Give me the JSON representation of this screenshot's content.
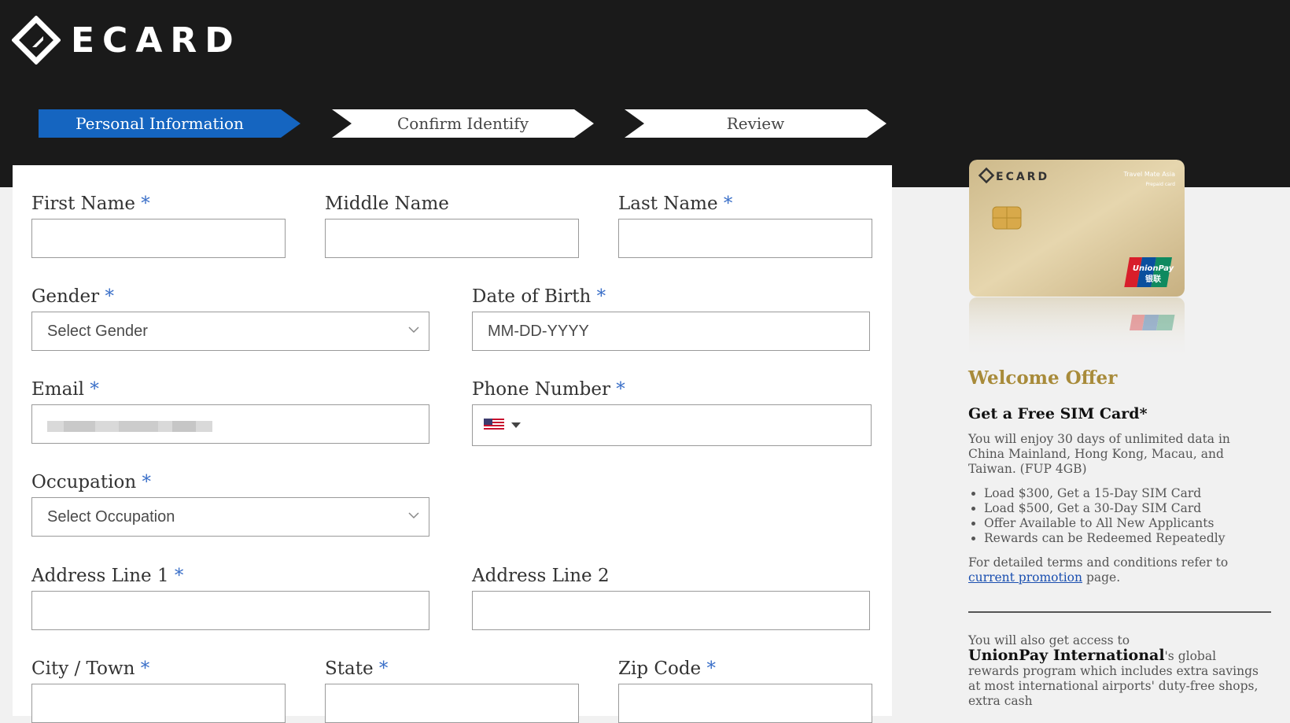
{
  "brand": {
    "name": "ECARD"
  },
  "steps": [
    {
      "label": "Personal Information",
      "active": true
    },
    {
      "label": "Confirm Identify",
      "active": false
    },
    {
      "label": "Review",
      "active": false
    }
  ],
  "form": {
    "first_name": {
      "label": "First Name",
      "required": "*",
      "value": ""
    },
    "middle_name": {
      "label": "Middle Name",
      "value": ""
    },
    "last_name": {
      "label": "Last Name",
      "required": "*",
      "value": ""
    },
    "gender": {
      "label": "Gender",
      "required": "*",
      "selected": "Select Gender"
    },
    "dob": {
      "label": "Date of Birth",
      "required": "*",
      "placeholder": "MM-DD-YYYY"
    },
    "email": {
      "label": "Email",
      "required": "*"
    },
    "phone": {
      "label": "Phone Number",
      "required": "*",
      "country_icon": "us-flag-icon"
    },
    "occupation": {
      "label": "Occupation",
      "required": "*",
      "selected": "Select Occupation"
    },
    "address1": {
      "label": "Address Line 1",
      "required": "*",
      "value": ""
    },
    "address2": {
      "label": "Address Line 2",
      "value": ""
    },
    "city": {
      "label": "City / Town",
      "required": "*"
    },
    "state": {
      "label": "State",
      "required": "*"
    },
    "zip": {
      "label": "Zip Code",
      "required": "*"
    }
  },
  "card": {
    "brand": "ECARD",
    "tagline": "Travel Mate Asia",
    "sub": "Prepaid card",
    "network": "UnionPay",
    "network_cn": "银联"
  },
  "offer": {
    "title": "Welcome Offer",
    "headline": "Get a Free SIM Card*",
    "description": "You will enjoy 30 days of unlimited data in China Mainland, Hong Kong, Macau, and Taiwan. (FUP 4GB)",
    "bullets": [
      "Load $300, Get a 15-Day SIM Card",
      "Load $500, Get a 30-Day SIM Card",
      "Offer Available to All New Applicants",
      "Rewards can be Redeemed Repeatedly"
    ],
    "terms_prefix": "For detailed terms and conditions refer to",
    "terms_link": "current promotion",
    "terms_suffix": "page.",
    "access_intro": "You will also get access to",
    "access_brand": "UnionPay International",
    "access_rest": "'s global rewards program which includes extra savings at most international airports' duty-free shops, extra cash"
  },
  "colors": {
    "active_step": "#1565c0",
    "header": "#1a1a1a",
    "accent_gold": "#a88b3a",
    "required": "#3a6fc8"
  }
}
